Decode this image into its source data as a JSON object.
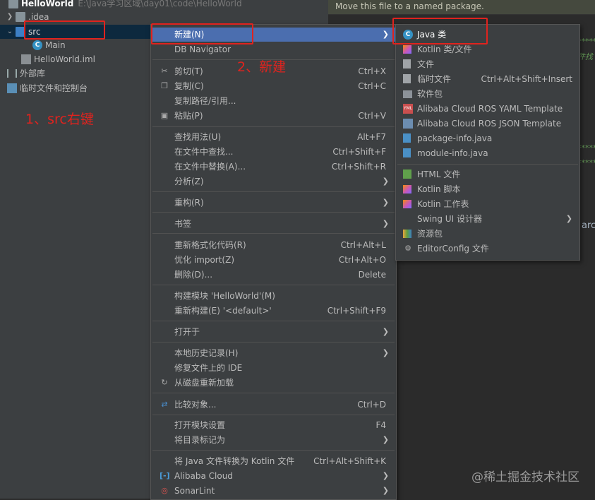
{
  "tree": {
    "project_name": "HelloWorld",
    "project_path": "E:\\Java学习区域\\day01\\code\\HelloWorld",
    "items": [
      {
        "label": ".idea"
      },
      {
        "label": "src"
      },
      {
        "label": "Main"
      },
      {
        "label": "HelloWorld.iml"
      },
      {
        "label": "外部库"
      },
      {
        "label": "临时文件和控制台"
      }
    ]
  },
  "editor": {
    "banner": "Move this file to a named package.",
    "gutter_text": "******",
    "side_text_1": "件找",
    "side_text_2": "arc"
  },
  "annotations": {
    "step1": "1、src右键",
    "step2": "2、新建"
  },
  "context_menu": {
    "items": [
      {
        "label": "新建(N)",
        "shortcut": ""
      },
      {
        "label": "DB Navigator",
        "shortcut": ""
      },
      {
        "label": "剪切(T)",
        "shortcut": "Ctrl+X"
      },
      {
        "label": "复制(C)",
        "shortcut": "Ctrl+C"
      },
      {
        "label": "复制路径/引用...",
        "shortcut": ""
      },
      {
        "label": "粘贴(P)",
        "shortcut": "Ctrl+V"
      },
      {
        "label": "查找用法(U)",
        "shortcut": "Alt+F7"
      },
      {
        "label": "在文件中查找...",
        "shortcut": "Ctrl+Shift+F"
      },
      {
        "label": "在文件中替换(A)...",
        "shortcut": "Ctrl+Shift+R"
      },
      {
        "label": "分析(Z)",
        "shortcut": ""
      },
      {
        "label": "重构(R)",
        "shortcut": ""
      },
      {
        "label": "书签",
        "shortcut": ""
      },
      {
        "label": "重新格式化代码(R)",
        "shortcut": "Ctrl+Alt+L"
      },
      {
        "label": "优化 import(Z)",
        "shortcut": "Ctrl+Alt+O"
      },
      {
        "label": "删除(D)...",
        "shortcut": "Delete"
      },
      {
        "label": "构建模块 'HelloWorld'(M)",
        "shortcut": ""
      },
      {
        "label": "重新构建(E) '<default>'",
        "shortcut": "Ctrl+Shift+F9"
      },
      {
        "label": "打开于",
        "shortcut": ""
      },
      {
        "label": "本地历史记录(H)",
        "shortcut": ""
      },
      {
        "label": "修复文件上的 IDE",
        "shortcut": ""
      },
      {
        "label": "从磁盘重新加载",
        "shortcut": ""
      },
      {
        "label": "比较对象...",
        "shortcut": "Ctrl+D"
      },
      {
        "label": "打开模块设置",
        "shortcut": "F4"
      },
      {
        "label": "将目录标记为",
        "shortcut": ""
      },
      {
        "label": "将 Java 文件转换为 Kotlin 文件",
        "shortcut": "Ctrl+Alt+Shift+K"
      },
      {
        "label": "Alibaba Cloud",
        "shortcut": ""
      },
      {
        "label": "SonarLint",
        "shortcut": ""
      }
    ]
  },
  "new_submenu": {
    "items": [
      {
        "label": "Java 类",
        "shortcut": ""
      },
      {
        "label": "Kotlin 类/文件",
        "shortcut": ""
      },
      {
        "label": "文件",
        "shortcut": ""
      },
      {
        "label": "临时文件",
        "shortcut": "Ctrl+Alt+Shift+Insert"
      },
      {
        "label": "软件包",
        "shortcut": ""
      },
      {
        "label": "Alibaba Cloud ROS YAML Template",
        "shortcut": ""
      },
      {
        "label": "Alibaba Cloud ROS JSON Template",
        "shortcut": ""
      },
      {
        "label": "package-info.java",
        "shortcut": ""
      },
      {
        "label": "module-info.java",
        "shortcut": ""
      },
      {
        "label": "HTML 文件",
        "shortcut": ""
      },
      {
        "label": "Kotlin 脚本",
        "shortcut": ""
      },
      {
        "label": "Kotlin 工作表",
        "shortcut": ""
      },
      {
        "label": "Swing UI 设计器",
        "shortcut": ""
      },
      {
        "label": "资源包",
        "shortcut": ""
      },
      {
        "label": "EditorConfig 文件",
        "shortcut": ""
      }
    ]
  },
  "watermark": "@稀土掘金技术社区",
  "colors": {
    "selection": "#4b6eaf",
    "annotation_red": "#e0231e",
    "panel": "#3c3f41"
  }
}
